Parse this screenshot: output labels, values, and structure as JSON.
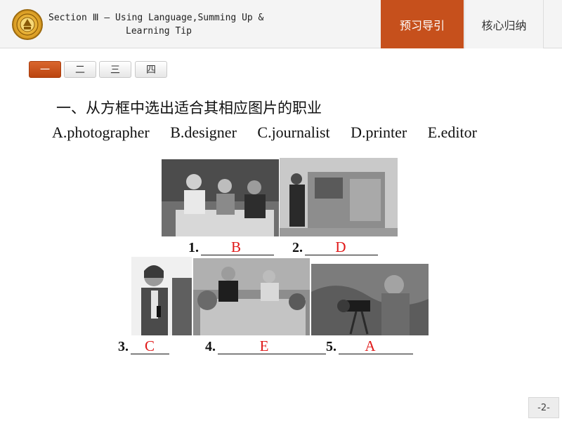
{
  "header": {
    "section_line1": "Section Ⅲ — Using Language,Summing Up &",
    "section_line2": "Learning Tip",
    "nav_active": "预习导引",
    "nav_inactive": "核心归纳"
  },
  "section_tabs": [
    "一",
    "二",
    "三",
    "四"
  ],
  "question": {
    "heading": "一、从方框中选出适合其相应图片的职业",
    "options": [
      "A.photographer",
      "B.designer",
      "C.journalist",
      "D.printer",
      "E.editor"
    ]
  },
  "items": [
    {
      "number": "1.",
      "answer": "B"
    },
    {
      "number": "2.",
      "answer": "D"
    },
    {
      "number": "3.",
      "answer": "C"
    },
    {
      "number": "4.",
      "answer": "E"
    },
    {
      "number": "5.",
      "answer": "A"
    }
  ],
  "photos": {
    "p1": "designers-at-table-photo",
    "p2": "printer-at-press-photo",
    "p3": "journalist-with-microphone-photo",
    "p4": "editors-meeting-photo",
    "p5": "photographer-with-camera-photo"
  },
  "page_number": "-2-",
  "colors": {
    "accent": "#c6501c",
    "answer": "#e01818"
  }
}
